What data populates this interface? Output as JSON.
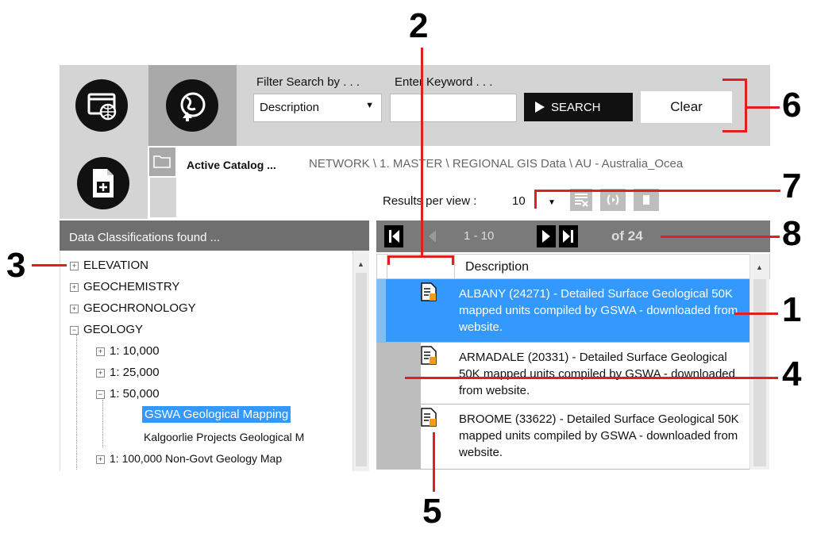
{
  "toolbar": {
    "filter_label": "Filter Search by . . .",
    "keyword_label": "Enter Keyword . . .",
    "filter_value": "Description",
    "keyword_value": "",
    "search_label": "SEARCH",
    "clear_label": "Clear",
    "icons": [
      "web-map-icon",
      "globe-upload-icon",
      "add-document-icon"
    ]
  },
  "catalog": {
    "label": "Active Catalog ...",
    "path": "NETWORK  \\  1. MASTER \\ REGIONAL GIS Data  \\  AU - Australia_Ocea"
  },
  "results": {
    "per_view_label": "Results per view :",
    "per_view_value": "10"
  },
  "left_panel": {
    "header": "Data Classifications found ...",
    "tree": [
      {
        "label": "ELEVATION",
        "toggle": "+"
      },
      {
        "label": "GEOCHEMISTRY",
        "toggle": "+"
      },
      {
        "label": "GEOCHRONOLOGY",
        "toggle": "+"
      },
      {
        "label": "GEOLOGY",
        "toggle": "−"
      },
      {
        "label": "1:  10,000",
        "toggle": "+"
      },
      {
        "label": "1:  25,000",
        "toggle": "+"
      },
      {
        "label": "1:  50,000",
        "toggle": "−"
      },
      {
        "label": "GSWA Geological Mapping",
        "toggle": ""
      },
      {
        "label": "Kalgoorlie Projects Geological M",
        "toggle": ""
      },
      {
        "label": "1: 100,000  Non-Govt Geology Map",
        "toggle": "+"
      }
    ]
  },
  "pager": {
    "range": "1 - 10",
    "of_label": "of",
    "total": "24"
  },
  "grid": {
    "column": "Description",
    "rows": [
      {
        "text": "ALBANY (24271) - Detailed Surface Geological 50K mapped units compiled by GSWA - downloaded from website."
      },
      {
        "text": "ARMADALE (20331) - Detailed Surface Geological 50K mapped units compiled by GSWA - downloaded from website."
      },
      {
        "text": "BROOME (33622) - Detailed Surface Geological 50K mapped units compiled by GSWA - downloaded from website."
      }
    ]
  },
  "callouts": [
    "1",
    "2",
    "3",
    "4",
    "5",
    "6",
    "7",
    "8"
  ],
  "colors": {
    "accent": "#3399ff",
    "annotation": "#e02020"
  }
}
